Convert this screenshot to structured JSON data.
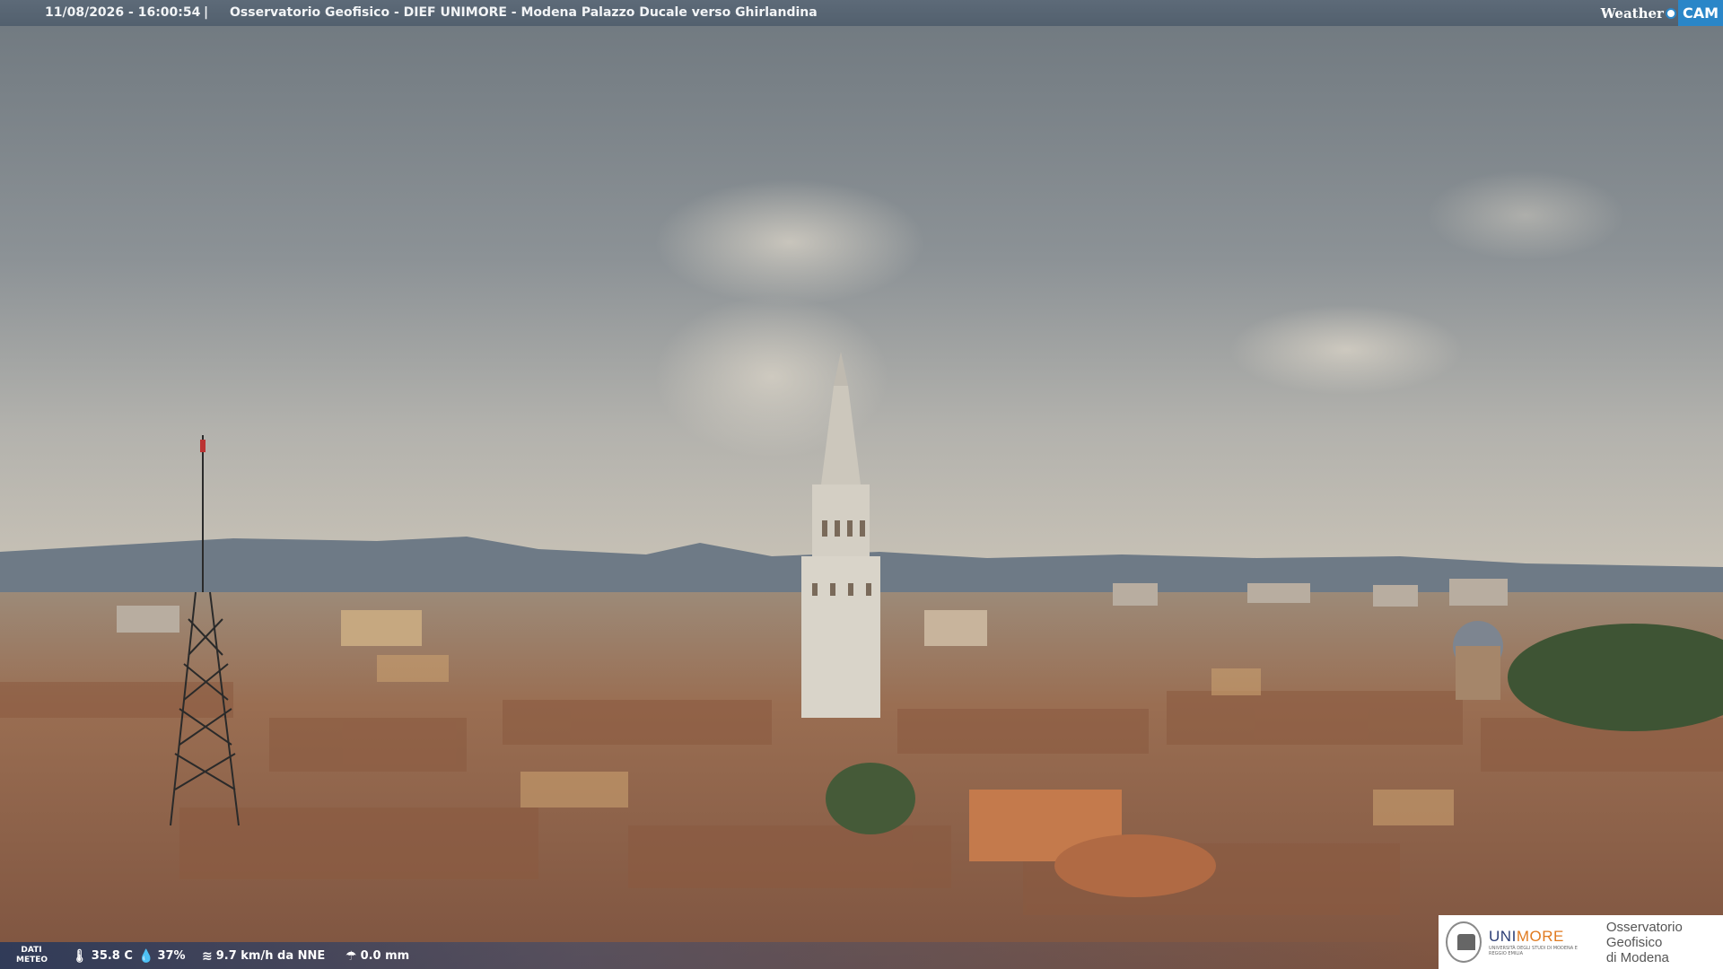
{
  "header": {
    "timestamp": "11/08/2026 - 16:00:54",
    "separator": "|",
    "title": "Osservatorio Geofisico - DIEF UNIMORE - Modena Palazzo Ducale verso Ghirlandina"
  },
  "brand": {
    "weather_text": "Weather",
    "cam_text": "CAM"
  },
  "meteo": {
    "label": "DATI METEO",
    "temperature": "35.8 C",
    "humidity": "37%",
    "wind": "9.7 km/h da NNE",
    "rain": "0.0 mm",
    "icons": [
      "thermometer-icon",
      "humidity-icon",
      "wind-icon",
      "rain-icon"
    ]
  },
  "logo": {
    "uni_a": "UNI",
    "uni_b": "MORE",
    "uni_sub": "UNIVERSITÀ DEGLI STUDI DI MODENA E REGGIO EMILIA",
    "observatory_line1": "Osservatorio Geofisico",
    "observatory_line2": "di Modena"
  },
  "colors": {
    "sky": "#8c9298",
    "roofs": "#9a6a4c",
    "tower": "#d8d4cc",
    "accent": "#2a86c8"
  }
}
